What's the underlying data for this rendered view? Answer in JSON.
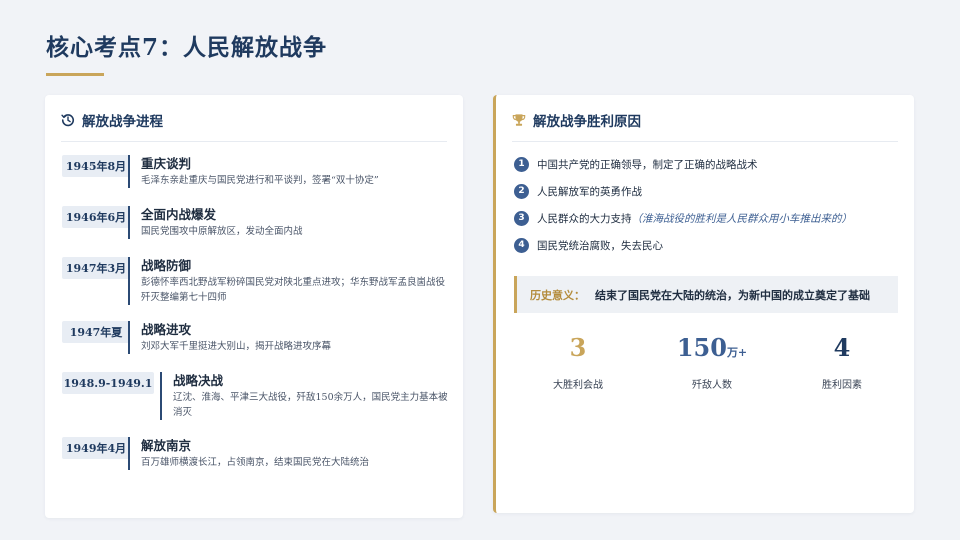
{
  "page_title": "核心考点7：人民解放战争",
  "left_card": {
    "header_icon": "history-icon",
    "header": "解放战争进程",
    "events": [
      {
        "date": "1945年8月",
        "title": "重庆谈判",
        "desc": "毛泽东亲赴重庆与国民党进行和平谈判，签署“双十协定”"
      },
      {
        "date": "1946年6月",
        "title": "全面内战爆发",
        "desc": "国民党围攻中原解放区，发动全面内战"
      },
      {
        "date": "1947年3月",
        "title": "战略防御",
        "desc": "彭德怀率西北野战军粉碎国民党对陕北重点进攻；华东野战军孟良崮战役歼灭整编第七十四师"
      },
      {
        "date": "1947年夏",
        "title": "战略进攻",
        "desc": "刘邓大军千里挺进大别山，揭开战略进攻序幕"
      },
      {
        "date": "1948.9-1949.1",
        "title": "战略决战",
        "desc": "辽沈、淮海、平津三大战役，歼敌150余万人，国民党主力基本被消灭"
      },
      {
        "date": "1949年4月",
        "title": "解放南京",
        "desc": "百万雄师横渡长江，占领南京，结束国民党在大陆统治"
      }
    ]
  },
  "right_card": {
    "header_icon": "trophy-icon",
    "header": "解放战争胜利原因",
    "reasons": [
      {
        "num": "1",
        "text": "中国共产党的正确领导，制定了正确的战略战术",
        "note": ""
      },
      {
        "num": "2",
        "text": "人民解放军的英勇作战",
        "note": ""
      },
      {
        "num": "3",
        "text": "人民群众的大力支持",
        "note": "（淮海战役的胜利是人民群众用小车推出来的）"
      },
      {
        "num": "4",
        "text": "国民党统治腐败，失去民心",
        "note": ""
      }
    ],
    "significance": {
      "label": "历史意义：",
      "text": "结束了国民党在大陆的统治，为新中国的成立奠定了基础"
    },
    "stats": [
      {
        "value": "3",
        "unit": "",
        "label": "大胜利会战",
        "color": "#c9a55a"
      },
      {
        "value": "150",
        "unit": "万+",
        "label": "歼敌人数",
        "color": "#3d5f92"
      },
      {
        "value": "4",
        "unit": "",
        "label": "胜利因素",
        "color": "#1f3a5f"
      }
    ]
  },
  "colors": {
    "navy": "#1f3a5f",
    "gold": "#c9a55a",
    "accent_blue": "#3d5f92",
    "background": "#f1f3f7"
  }
}
